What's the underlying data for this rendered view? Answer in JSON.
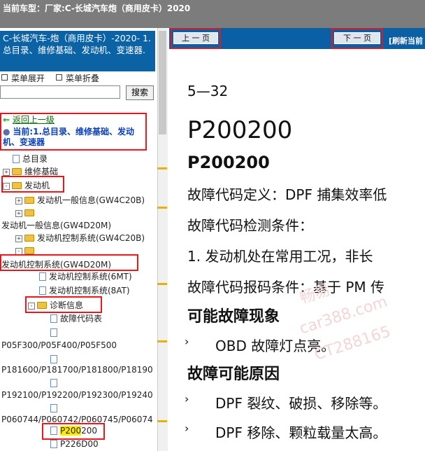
{
  "window": {
    "title": "当前车型：厂家:C-长城汽车炮（商用皮卡）2020"
  },
  "left": {
    "header": "C-长城汽车-炮（商用皮卡）-2020- 1.总目录、维修基础、发动机、变速器.",
    "menu_expand": "菜单展开",
    "menu_collapse": "菜单折叠",
    "search_button": "搜索",
    "search_value": "",
    "tree": {
      "back": "返回上一级",
      "current": "当前:1.总目录、维修基础、发动机、变速器",
      "items": [
        "总目录",
        "维修基础",
        "发动机",
        "发动机一般信息(GW4C20B)",
        "发动机一般信息(GW4D20M)",
        "发动机控制系统(GW4C20B)",
        "发动机控制系统(GW4D20M)",
        "发动机控制系统(6MT)",
        "发动机控制系统(8AT)",
        "诊断信息",
        "故障代码表",
        "P05F300/P05F400/P05F500",
        "P181600/P181700/P181800/P18190",
        "P192100/P192200/P192300/P19240",
        "P060744/P060742/P060745/P06074",
        "P200",
        "200",
        "P226D00"
      ]
    }
  },
  "right": {
    "prev_button": "上 一 页",
    "next_button": "下 一 页",
    "refresh": "[刷新当前",
    "doc": {
      "page_no": "5—32",
      "code_large": "P200200",
      "code_small": "P200200",
      "line1": "故障代码定义：DPF 捕集效率低",
      "line2": "故障代码检测条件：",
      "line3": "1.   发动机处在常用工况，非长",
      "line4": "故障代码报码条件：基于 PM 传",
      "h1": "可能故障现象",
      "b1": "OBD 故障灯点亮。",
      "h2": "故障可能原因",
      "b2": "DPF 裂纹、破损、移除等。",
      "b3": "DPF 移除、颗粒载量太高。",
      "bullet": "›",
      "watermark": [
        "畅易",
        "car388.com",
        "CT288165"
      ]
    }
  }
}
